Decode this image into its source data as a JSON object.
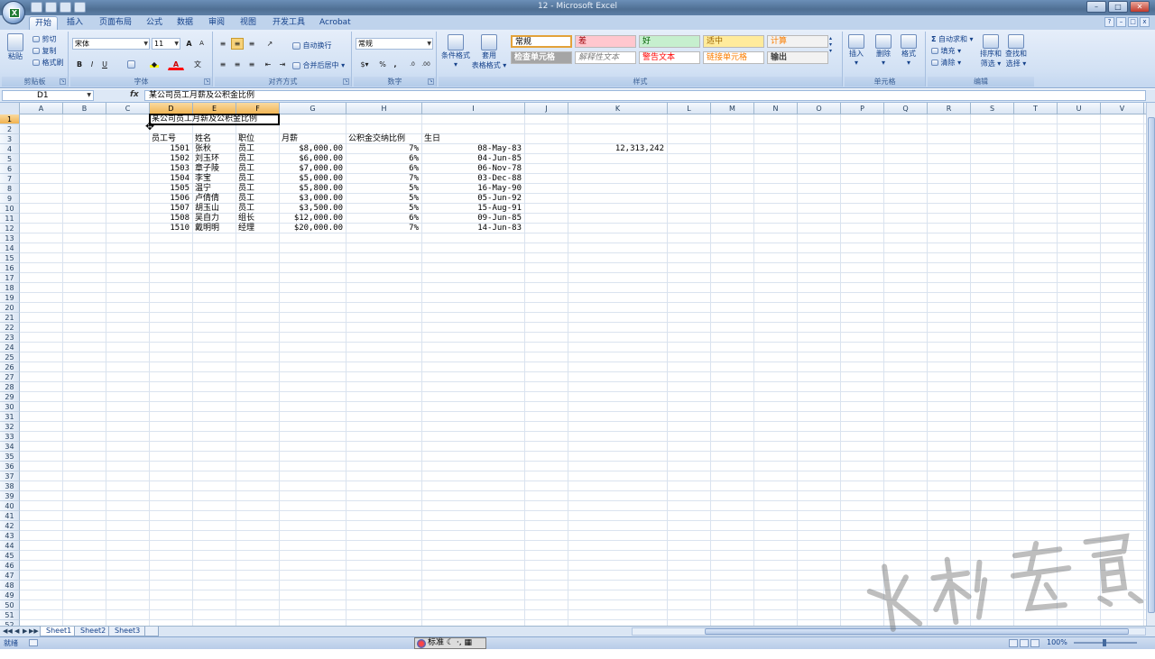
{
  "window": {
    "title": "12 - Microsoft Excel",
    "buttons": [
      "–",
      "□",
      "✕"
    ]
  },
  "app_logo": "X",
  "ribbon_tabs": [
    {
      "label": "开始",
      "active": true
    },
    {
      "label": "插入"
    },
    {
      "label": "页面布局"
    },
    {
      "label": "公式"
    },
    {
      "label": "数据"
    },
    {
      "label": "审阅"
    },
    {
      "label": "视图"
    },
    {
      "label": "开发工具"
    },
    {
      "label": "Acrobat"
    }
  ],
  "clipboard": {
    "paste": "粘贴",
    "cut": "剪切",
    "copy": "复制",
    "format_painter": "格式刷",
    "label": "剪贴板"
  },
  "font": {
    "name": "宋体",
    "size": "11",
    "bold": "B",
    "italic": "I",
    "underline": "U",
    "grow": "A",
    "shrink": "A",
    "label": "字体"
  },
  "alignment": {
    "wrap": "自动换行",
    "merge": "合并后居中",
    "label": "对齐方式"
  },
  "number": {
    "format": "常规",
    "percent": "%",
    "comma": ",",
    "label": "数字"
  },
  "styles": {
    "conditional": "条件格式",
    "table": "套用",
    "table2": "表格格式",
    "cells": [
      {
        "label": "常规",
        "bg": "#ffffff",
        "fg": "#000000",
        "border": "#e3a23a"
      },
      {
        "label": "差",
        "bg": "#ffc7ce",
        "fg": "#9c0006"
      },
      {
        "label": "好",
        "bg": "#c6efce",
        "fg": "#006100"
      },
      {
        "label": "适中",
        "bg": "#ffeb9c",
        "fg": "#9c6500"
      },
      {
        "label": "计算",
        "bg": "#f2f2f2",
        "fg": "#fa7d00"
      },
      {
        "label": "检查单元格",
        "bg": "#a5a5a5",
        "fg": "#ffffff"
      },
      {
        "label": "解释性文本",
        "bg": "#ffffff",
        "fg": "#7f7f7f"
      },
      {
        "label": "警告文本",
        "bg": "#ffffff",
        "fg": "#ff0000"
      },
      {
        "label": "链接单元格",
        "bg": "#ffffff",
        "fg": "#fa7d00"
      },
      {
        "label": "输出",
        "bg": "#f2f2f2",
        "fg": "#3f3f3f"
      }
    ],
    "label": "样式"
  },
  "cells_group": {
    "insert": "插入",
    "delete": "删除",
    "format": "格式",
    "label": "单元格"
  },
  "editing": {
    "autosum": "自动求和",
    "fill": "填充",
    "clear": "清除",
    "sort": "排序和",
    "sort2": "筛选",
    "find": "查找和",
    "find2": "选择",
    "label": "编辑"
  },
  "formula_bar": {
    "name_box": "D1",
    "fx": "fx",
    "content": "某公司员工月薪及公积金比例"
  },
  "columns": [
    "A",
    "B",
    "C",
    "D",
    "E",
    "F",
    "G",
    "H",
    "I",
    "J",
    "K",
    "L",
    "M",
    "N",
    "O",
    "P",
    "Q",
    "R",
    "S",
    "T",
    "U",
    "V"
  ],
  "row_numbers": [
    "1",
    "2",
    "3",
    "4",
    "5",
    "6",
    "7",
    "8",
    "9",
    "10",
    "11",
    "12",
    "13",
    "14",
    "15",
    "16",
    "17",
    "18",
    "19",
    "20",
    "21",
    "22",
    "23",
    "24",
    "25",
    "26",
    "27",
    "28",
    "29",
    "30",
    "31",
    "32",
    "33",
    "34",
    "35",
    "36",
    "37",
    "38",
    "39",
    "40",
    "41",
    "42",
    "43",
    "44",
    "45",
    "46",
    "47",
    "48",
    "49",
    "50",
    "51",
    "52"
  ],
  "sheet": {
    "title": "某公司员工月薪及公积金比例",
    "headers": [
      "员工号",
      "姓名",
      "职位",
      "月薪",
      "公积金交纳比例",
      "生日"
    ],
    "rows": [
      [
        "1501",
        "张秋",
        "员工",
        "$8,000.00",
        "7%",
        "08-May-83"
      ],
      [
        "1502",
        "刘玉环",
        "员工",
        "$6,000.00",
        "6%",
        "04-Jun-85"
      ],
      [
        "1503",
        "章子陵",
        "员工",
        "$7,000.00",
        "6%",
        "06-Nov-78"
      ],
      [
        "1504",
        "李宝",
        "员工",
        "$5,000.00",
        "7%",
        "03-Dec-88"
      ],
      [
        "1505",
        "温宁",
        "员工",
        "$5,800.00",
        "5%",
        "16-May-90"
      ],
      [
        "1506",
        "卢倩倩",
        "员工",
        "$3,000.00",
        "5%",
        "05-Jun-92"
      ],
      [
        "1507",
        "胡玉山",
        "员工",
        "$3,500.00",
        "5%",
        "15-Aug-91"
      ],
      [
        "1508",
        "吴自力",
        "组长",
        "$12,000.00",
        "6%",
        "09-Jun-85"
      ],
      [
        "1510",
        "戴明明",
        "经理",
        "$20,000.00",
        "7%",
        "14-Jun-83"
      ]
    ],
    "k4": "12,313,242"
  },
  "sheet_tabs": [
    {
      "label": "Sheet1",
      "active": true
    },
    {
      "label": "Sheet2"
    },
    {
      "label": "Sheet3"
    }
  ],
  "status": {
    "ready": "就绪",
    "ime": "标准",
    "zoom": "100%"
  },
  "watermark": "水利考资"
}
